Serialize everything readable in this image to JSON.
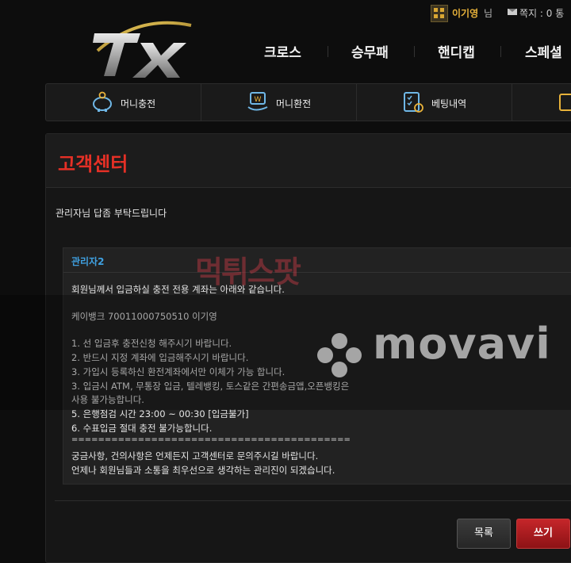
{
  "top": {
    "user_name": "이기영",
    "user_suffix": "님",
    "message_label": "쪽지 : 0 통"
  },
  "logo": {
    "text": "TX"
  },
  "nav": [
    "크로스",
    "승무패",
    "핸디캡",
    "스페셜"
  ],
  "quick_menu": [
    {
      "label": "머니충전",
      "icon": "piggy-bank-icon"
    },
    {
      "label": "머니환전",
      "icon": "money-exchange-icon"
    },
    {
      "label": "베팅내역",
      "icon": "checklist-icon"
    },
    {
      "label": "",
      "icon": "coupon-icon"
    }
  ],
  "page": {
    "title": "고객센터",
    "post_title": "관리자님 답좀 부탁드립니다"
  },
  "reply": {
    "author": "관리자2",
    "lines": [
      "회원님께서 입금하실 충전 전용 계좌는 아래와 같습니다.",
      "케이뱅크 70011000750510 이기영",
      "1. 선 입금후 충전신청 해주시기 바랍니다.",
      "2. 반드시 지정 계좌에 입금해주시기 바랍니다.",
      "3. 가입시 등록하신 환전계좌에서만 이체가 가능 합니다.",
      "3. 입금시 ATM, 무통장 입금, 텔레뱅킹, 토스같은 간편송금앱,오픈뱅킹은",
      "사용 불가능합니다.",
      "5. 은행점검 시간 23:00 ~ 00:30 [입금불가]",
      "6. 수표입금 절대 충전 불가능합니다.",
      "==========================================",
      "궁금사항, 건의사항은 언제든지 고객센터로 문의주시길 바랍니다.",
      "언제나 회원님들과 소통을 최우선으로 생각하는 관리진이 되겠습니다."
    ]
  },
  "buttons": {
    "list": "목록",
    "write": "쓰기"
  },
  "watermarks": {
    "movavi": "movavi",
    "mtsp": "먹튀스팟"
  },
  "colors": {
    "title_red": "#e53026",
    "author_blue": "#3fa0e0",
    "gold": "#e8b23a"
  }
}
